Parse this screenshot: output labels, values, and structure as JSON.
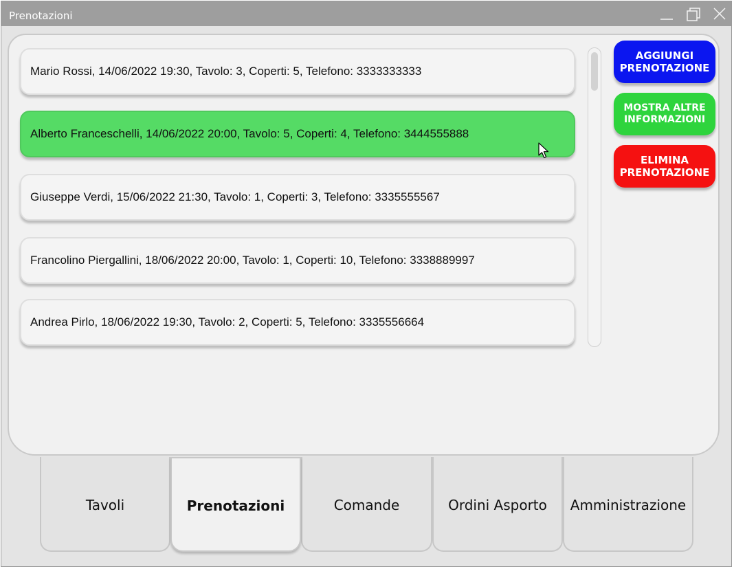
{
  "window": {
    "title": "Prenotazioni"
  },
  "reservations": [
    {
      "text": "Mario Rossi, 14/06/2022 19:30, Tavolo: 3, Coperti: 5, Telefono: 3333333333",
      "selected": false
    },
    {
      "text": "Alberto Franceschelli, 14/06/2022 20:00, Tavolo: 5, Coperti: 4, Telefono: 3444555888",
      "selected": true
    },
    {
      "text": "Giuseppe Verdi, 15/06/2022 21:30, Tavolo: 1, Coperti: 3, Telefono: 3335555567",
      "selected": false
    },
    {
      "text": "Francolino Piergallini, 18/06/2022 20:00, Tavolo: 1, Coperti: 10, Telefono: 3338889997",
      "selected": false
    },
    {
      "text": "Andrea Pirlo, 18/06/2022 19:30, Tavolo: 2, Coperti: 5, Telefono: 3335556664",
      "selected": false
    }
  ],
  "actions": {
    "add_label": "AGGIUNGI PRENOTAZIONE",
    "info_label": "MOSTRA ALTRE INFORMAZIONI",
    "delete_label": "ELIMINA PRENOTAZIONE"
  },
  "tabs": [
    {
      "label": "Tavoli",
      "active": false
    },
    {
      "label": "Prenotazioni",
      "active": true
    },
    {
      "label": "Comande",
      "active": false
    },
    {
      "label": "Ordini Asporto",
      "active": false
    },
    {
      "label": "Amministrazione",
      "active": false
    }
  ],
  "colors": {
    "selected_row": "#55db65",
    "add_button": "#0b16f0",
    "info_button": "#2ed43d",
    "delete_button": "#f51111",
    "titlebar": "#9e9e9e"
  },
  "icons": {
    "minimize": "minimize-icon",
    "maximize": "maximize-icon",
    "close": "close-icon",
    "cursor": "mouse-pointer-icon"
  }
}
